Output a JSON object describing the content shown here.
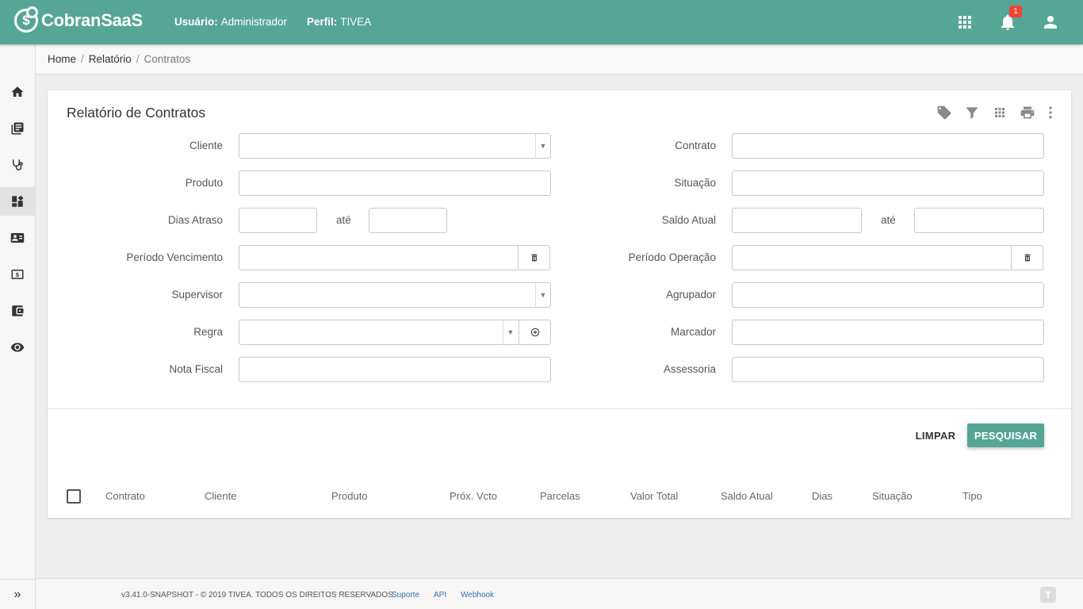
{
  "brand": {
    "name": "CobranSaaS",
    "symbol": "$"
  },
  "header": {
    "user_label": "Usuário:",
    "user_value": "Administrador",
    "profile_label": "Perfil:",
    "profile_value": "TIVEA",
    "notification_count": "1",
    "accent_color": "#56a697"
  },
  "sidebar": {
    "items": [
      {
        "icon": "home-icon"
      },
      {
        "icon": "library-books-icon"
      },
      {
        "icon": "stethoscope-icon"
      },
      {
        "icon": "dashboard-icon",
        "active": true
      },
      {
        "icon": "contact-card-icon"
      },
      {
        "icon": "money-icon"
      },
      {
        "icon": "wallet-icon"
      },
      {
        "icon": "eye-icon"
      }
    ],
    "expand_icon": "»"
  },
  "breadcrumb": {
    "home": "Home",
    "report": "Relatório",
    "current": "Contratos",
    "separator": "/"
  },
  "card": {
    "title": "Relatório de Contratos",
    "tools": [
      "tag-icon",
      "filter-icon",
      "grid-icon",
      "print-icon",
      "more-vert-icon"
    ]
  },
  "form": {
    "cliente": "Cliente",
    "produto": "Produto",
    "dias_atraso": "Dias Atraso",
    "periodo_vencimento": "Período Vencimento",
    "supervisor": "Supervisor",
    "regra": "Regra",
    "nota_fiscal": "Nota Fiscal",
    "contrato": "Contrato",
    "situacao": "Situação",
    "saldo_atual": "Saldo Atual",
    "periodo_operacao": "Período Operação",
    "agrupador": "Agrupador",
    "marcador": "Marcador",
    "assessoria": "Assessoria",
    "ate": "até",
    "dropdown_glyph": "▼"
  },
  "actions": {
    "clear": "LIMPAR",
    "search": "PESQUISAR"
  },
  "table": {
    "columns": [
      "Contrato",
      "Cliente",
      "Produto",
      "Próx. Vcto",
      "Parcelas",
      "Valor Total",
      "Saldo Atual",
      "Dias",
      "Situação",
      "Tipo"
    ]
  },
  "footer": {
    "copyright": "v3.41.0-SNAPSHOT - © 2019 TIVEA. TODOS OS DIREITOS RESERVADOS.",
    "links": [
      "Suporte",
      "API",
      "Webhook"
    ],
    "logo_glyph": "T"
  }
}
